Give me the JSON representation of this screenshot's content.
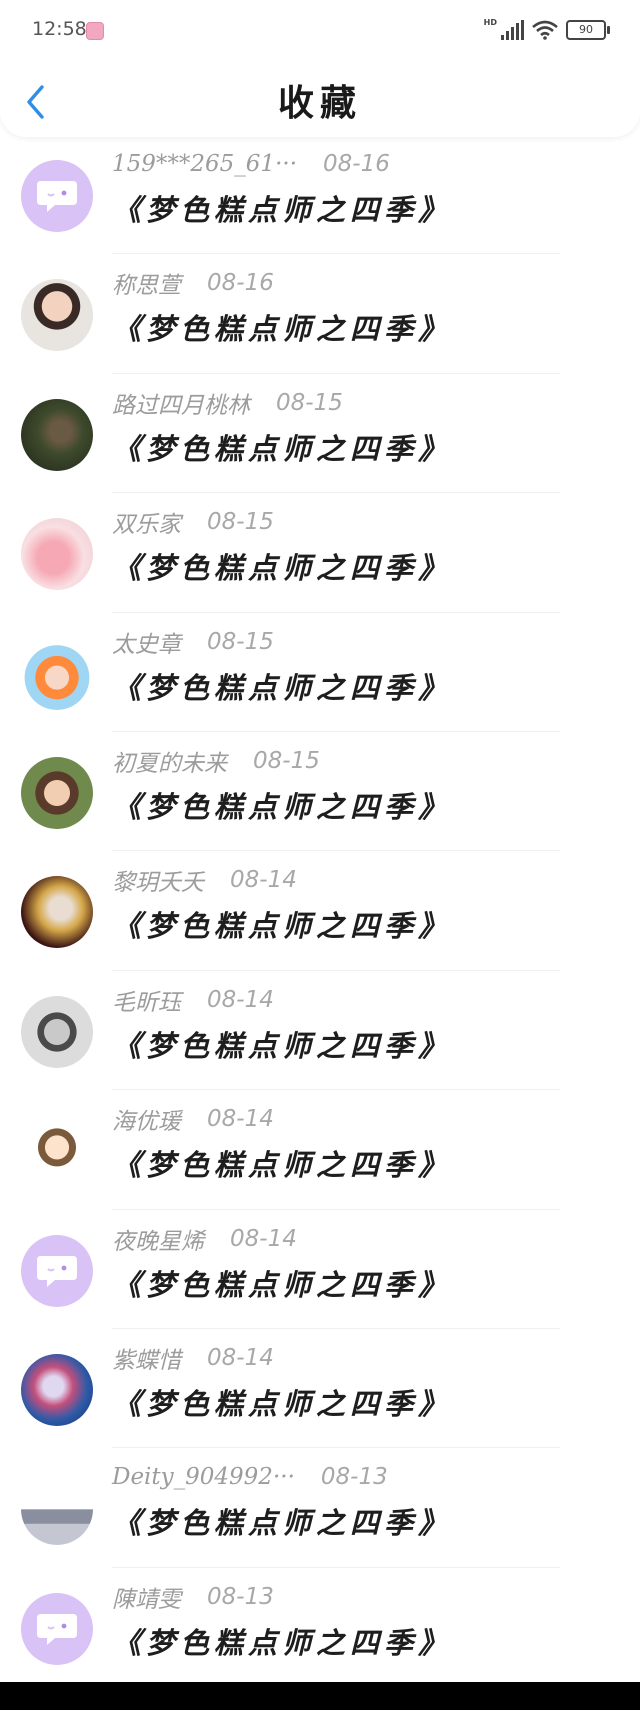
{
  "status_bar": {
    "time": "12:58",
    "battery": "90",
    "network": "HD"
  },
  "header": {
    "title": "收藏"
  },
  "items": [
    {
      "user": "159***265_61···",
      "date": "08-16",
      "book": "《梦色糕点师之四季》",
      "avatar": "default"
    },
    {
      "user": "称思萱",
      "date": "08-16",
      "book": "《梦色糕点师之四季》",
      "avatar": "photo-1"
    },
    {
      "user": "路过四月桃林",
      "date": "08-15",
      "book": "《梦色糕点师之四季》",
      "avatar": "photo-2"
    },
    {
      "user": "双乐家",
      "date": "08-15",
      "book": "《梦色糕点师之四季》",
      "avatar": "photo-3"
    },
    {
      "user": "太史章",
      "date": "08-15",
      "book": "《梦色糕点师之四季》",
      "avatar": "photo-4"
    },
    {
      "user": "初夏的未来",
      "date": "08-15",
      "book": "《梦色糕点师之四季》",
      "avatar": "photo-5"
    },
    {
      "user": "黎玥夭夭",
      "date": "08-14",
      "book": "《梦色糕点师之四季》",
      "avatar": "photo-6"
    },
    {
      "user": "毛昕珏",
      "date": "08-14",
      "book": "《梦色糕点师之四季》",
      "avatar": "photo-7"
    },
    {
      "user": "海优瑗",
      "date": "08-14",
      "book": "《梦色糕点师之四季》",
      "avatar": "photo-8"
    },
    {
      "user": "夜晚星烯",
      "date": "08-14",
      "book": "《梦色糕点师之四季》",
      "avatar": "default"
    },
    {
      "user": "紫蝶惜",
      "date": "08-14",
      "book": "《梦色糕点师之四季》",
      "avatar": "photo-9"
    },
    {
      "user": "Deity_904992···",
      "date": "08-13",
      "book": "《梦色糕点师之四季》",
      "avatar": "photo-10"
    },
    {
      "user": "陳靖雯",
      "date": "08-13",
      "book": "《梦色糕点师之四季》",
      "avatar": "default"
    }
  ],
  "colors": {
    "accent": "#2f8fe6",
    "default_avatar_bg": "#d9c2f5"
  }
}
